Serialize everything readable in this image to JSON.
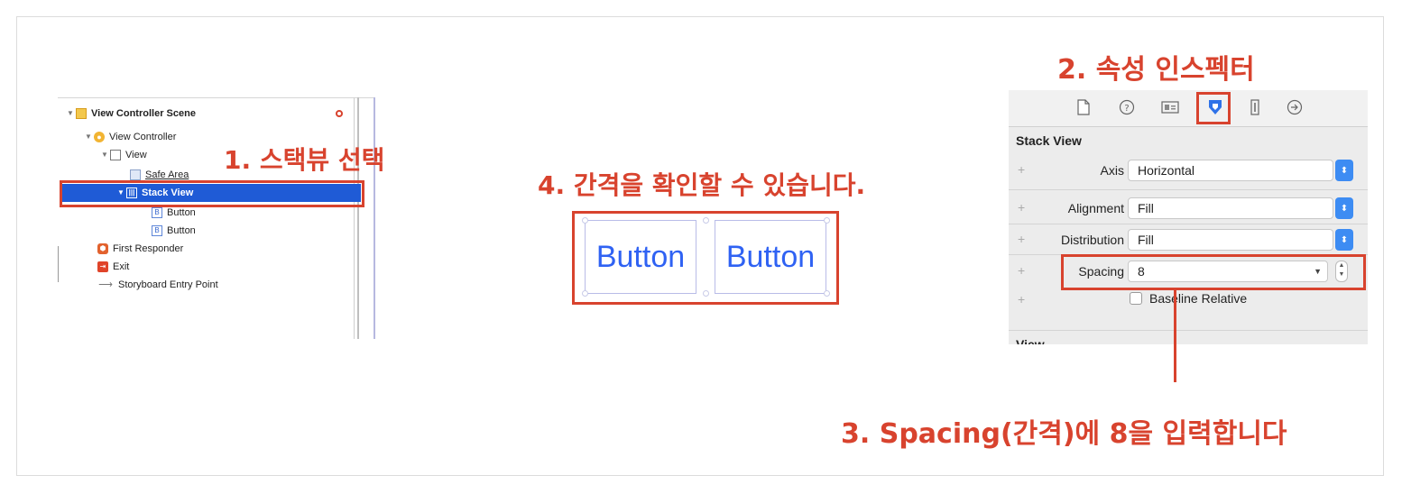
{
  "annotations": {
    "step1": "1. 스택뷰 선택",
    "step2": "2. 속성 인스펙터",
    "step3": "3. Spacing(간격)에 8을 입력합니다",
    "step4": "4. 간격을 확인할 수 있습니다."
  },
  "outline": {
    "items": [
      {
        "label": "View Controller Scene",
        "icon": "scene-icon"
      },
      {
        "label": "View Controller",
        "icon": "view-controller-icon"
      },
      {
        "label": "View",
        "icon": "view-icon"
      },
      {
        "label": "Safe Area",
        "icon": "safe-area-icon"
      },
      {
        "label": "Stack View",
        "icon": "stack-view-icon",
        "selected": true
      },
      {
        "label": "Button",
        "icon": "button-icon"
      },
      {
        "label": "Button",
        "icon": "button-icon"
      },
      {
        "label": "First Responder",
        "icon": "first-responder-icon"
      },
      {
        "label": "Exit",
        "icon": "exit-icon"
      },
      {
        "label": "Storyboard Entry Point",
        "icon": "arrow-right-icon"
      }
    ]
  },
  "canvas": {
    "buttons": [
      "Button",
      "Button"
    ]
  },
  "inspector": {
    "toolbar_icons": [
      "file-icon",
      "help-icon",
      "identity-icon",
      "attributes-icon",
      "size-icon",
      "connections-icon"
    ],
    "section_title": "Stack View",
    "axis": {
      "label": "Axis",
      "value": "Horizontal"
    },
    "alignment": {
      "label": "Alignment",
      "value": "Fill"
    },
    "distribution": {
      "label": "Distribution",
      "value": "Fill"
    },
    "spacing": {
      "label": "Spacing",
      "value": "8"
    },
    "baseline_relative": {
      "label": "Baseline Relative",
      "checked": false
    },
    "next_section": "View"
  },
  "colors": {
    "annotation_red": "#d8432e",
    "selection_blue": "#1f5bd6",
    "button_blue": "#2f62f3",
    "popup_blue": "#3d8cf3"
  }
}
